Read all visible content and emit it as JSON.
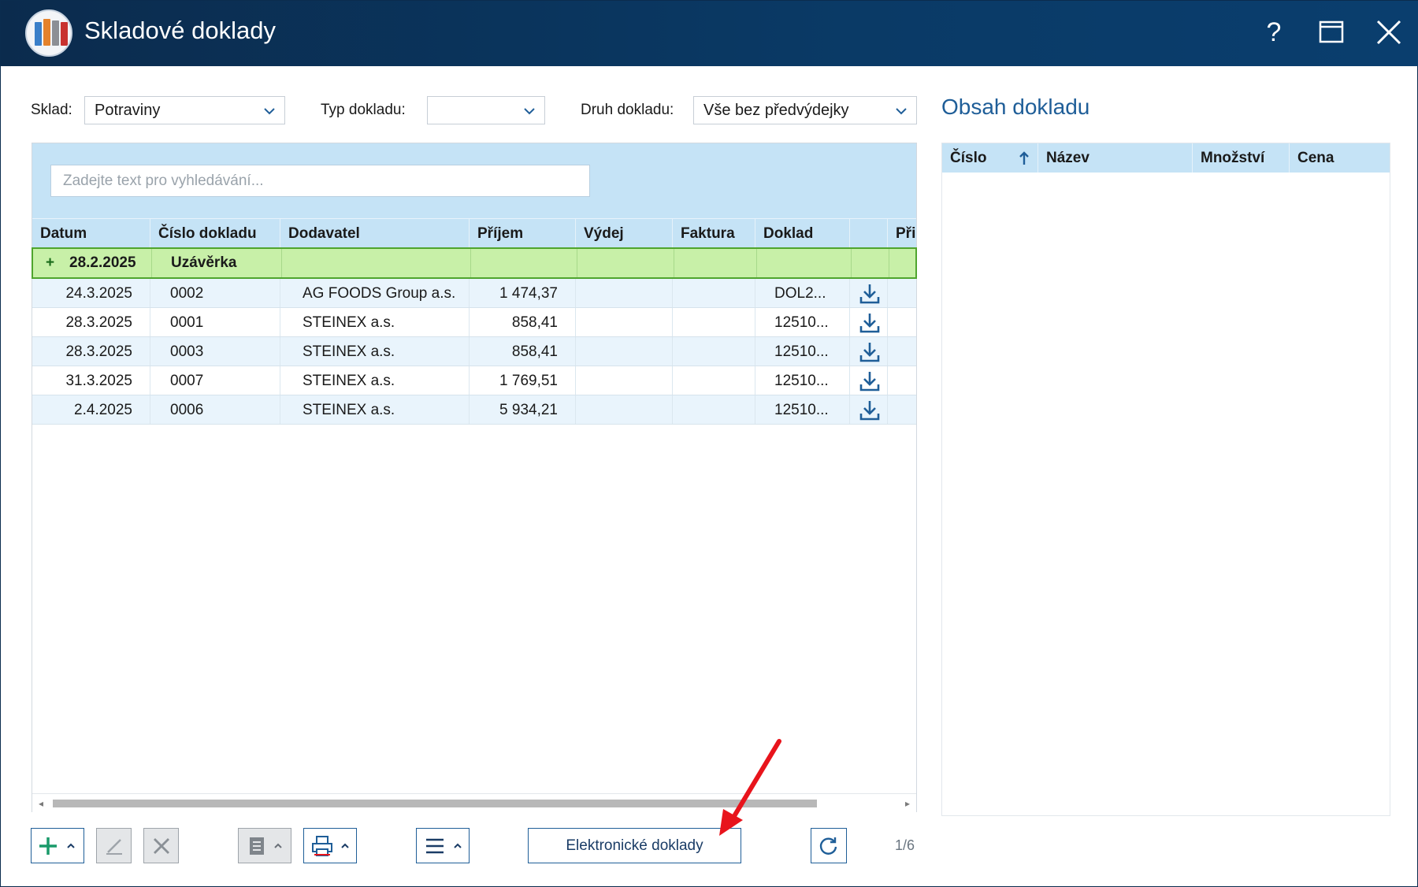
{
  "window": {
    "title": "Skladové doklady"
  },
  "filters": {
    "sklad_label": "Sklad:",
    "sklad_value": "Potraviny",
    "typ_label": "Typ dokladu:",
    "typ_value": "",
    "druh_label": "Druh dokladu:",
    "druh_value": "Vše bez předvýdejky"
  },
  "search": {
    "placeholder": "Zadejte text pro vyhledávání..."
  },
  "table": {
    "columns": [
      "Datum",
      "Číslo dokladu",
      "Dodavatel",
      "Příjem",
      "Výdej",
      "Faktura",
      "Doklad",
      "",
      "Při"
    ],
    "group": {
      "expander": "+",
      "date": "28.2.2025",
      "label": "Uzávěrka"
    },
    "rows": [
      {
        "datum": "24.3.2025",
        "cislo": "0002",
        "dodavatel": "AG FOODS Group a.s.",
        "prijem": "1 474,37",
        "vydej": "",
        "faktura": "",
        "doklad": "DOL2..."
      },
      {
        "datum": "28.3.2025",
        "cislo": "0001",
        "dodavatel": "STEINEX a.s.",
        "prijem": "858,41",
        "vydej": "",
        "faktura": "",
        "doklad": "12510..."
      },
      {
        "datum": "28.3.2025",
        "cislo": "0003",
        "dodavatel": "STEINEX a.s.",
        "prijem": "858,41",
        "vydej": "",
        "faktura": "",
        "doklad": "12510..."
      },
      {
        "datum": "31.3.2025",
        "cislo": "0007",
        "dodavatel": "STEINEX a.s.",
        "prijem": "1 769,51",
        "vydej": "",
        "faktura": "",
        "doklad": "12510..."
      },
      {
        "datum": "2.4.2025",
        "cislo": "0006",
        "dodavatel": "STEINEX a.s.",
        "prijem": "5 934,21",
        "vydej": "",
        "faktura": "",
        "doklad": "12510..."
      }
    ]
  },
  "detail": {
    "title": "Obsah dokladu",
    "columns": [
      "Číslo",
      "Název",
      "Množství",
      "Cena"
    ]
  },
  "toolbar": {
    "elektronicke_label": "Elektronické doklady",
    "pager": "1/6"
  },
  "colors": {
    "titlebar": "#0a3a66",
    "header_bg": "#c5e3f6",
    "group_bg": "#c8f0a8",
    "accent": "#1f5e98",
    "annotation": "#e8141c"
  }
}
